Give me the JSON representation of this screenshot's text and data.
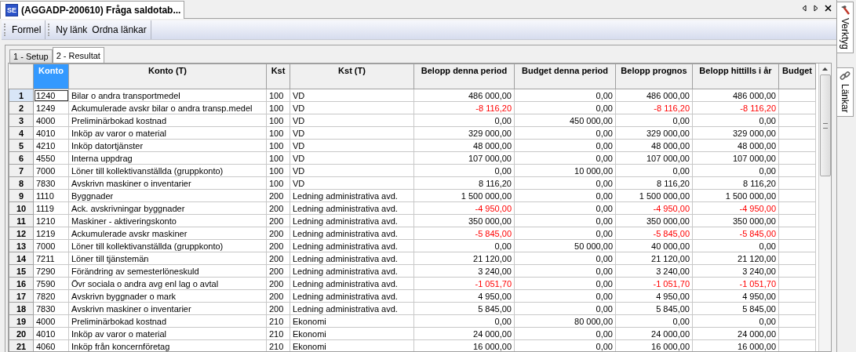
{
  "document_tab": {
    "icon_text": "SE",
    "title": "(AGGADP-200610) Fråga saldotab..."
  },
  "toolbar": [
    {
      "buttons": [
        "Formel"
      ]
    },
    {
      "buttons": [
        "Ny länk",
        "Ordna länkar"
      ]
    }
  ],
  "tabs": [
    {
      "label": "1 - Setup",
      "selected": false
    },
    {
      "label": "2 - Resultat",
      "selected": true
    }
  ],
  "side_tabs": [
    {
      "label": "Verktyg",
      "kind": "tools"
    },
    {
      "label": "Länkar",
      "kind": "links"
    }
  ],
  "table": {
    "columns": [
      {
        "label": "Konto",
        "selected": true
      },
      {
        "label": "Konto (T)",
        "selected": false
      },
      {
        "label": "Kst",
        "selected": false
      },
      {
        "label": "Kst (T)",
        "selected": false
      },
      {
        "label": "Belopp denna period",
        "selected": false
      },
      {
        "label": "Budget denna period",
        "selected": false
      },
      {
        "label": "Belopp prognos",
        "selected": false
      },
      {
        "label": "Belopp hittills i år",
        "selected": false
      },
      {
        "label": "Budget",
        "selected": false
      }
    ],
    "rows": [
      {
        "number": "1",
        "selected": true,
        "cells": [
          {
            "text": "1240",
            "negative": false
          },
          {
            "text": "Bilar o andra transportmedel",
            "negative": false
          },
          {
            "text": "100",
            "negative": false
          },
          {
            "text": "VD",
            "negative": false
          },
          {
            "text": "486 000,00",
            "negative": false
          },
          {
            "text": "0,00",
            "negative": false
          },
          {
            "text": "486 000,00",
            "negative": false
          },
          {
            "text": "486 000,00",
            "negative": false
          }
        ]
      },
      {
        "number": "2",
        "selected": false,
        "cells": [
          {
            "text": "1249",
            "negative": false
          },
          {
            "text": "Ackumulerade avskr bilar o andra transp.medel",
            "negative": false
          },
          {
            "text": "100",
            "negative": false
          },
          {
            "text": "VD",
            "negative": false
          },
          {
            "text": "-8 116,20",
            "negative": true
          },
          {
            "text": "0,00",
            "negative": false
          },
          {
            "text": "-8 116,20",
            "negative": true
          },
          {
            "text": "-8 116,20",
            "negative": true
          }
        ]
      },
      {
        "number": "3",
        "selected": false,
        "cells": [
          {
            "text": "4000",
            "negative": false
          },
          {
            "text": "Preliminärbokad kostnad",
            "negative": false
          },
          {
            "text": "100",
            "negative": false
          },
          {
            "text": "VD",
            "negative": false
          },
          {
            "text": "0,00",
            "negative": false
          },
          {
            "text": "450 000,00",
            "negative": false
          },
          {
            "text": "0,00",
            "negative": false
          },
          {
            "text": "0,00",
            "negative": false
          }
        ]
      },
      {
        "number": "4",
        "selected": false,
        "cells": [
          {
            "text": "4010",
            "negative": false
          },
          {
            "text": "Inköp av varor o material",
            "negative": false
          },
          {
            "text": "100",
            "negative": false
          },
          {
            "text": "VD",
            "negative": false
          },
          {
            "text": "329 000,00",
            "negative": false
          },
          {
            "text": "0,00",
            "negative": false
          },
          {
            "text": "329 000,00",
            "negative": false
          },
          {
            "text": "329 000,00",
            "negative": false
          }
        ]
      },
      {
        "number": "5",
        "selected": false,
        "cells": [
          {
            "text": "4210",
            "negative": false
          },
          {
            "text": "Inköp datortjänster",
            "negative": false
          },
          {
            "text": "100",
            "negative": false
          },
          {
            "text": "VD",
            "negative": false
          },
          {
            "text": "48 000,00",
            "negative": false
          },
          {
            "text": "0,00",
            "negative": false
          },
          {
            "text": "48 000,00",
            "negative": false
          },
          {
            "text": "48 000,00",
            "negative": false
          }
        ]
      },
      {
        "number": "6",
        "selected": false,
        "cells": [
          {
            "text": "4550",
            "negative": false
          },
          {
            "text": "Interna uppdrag",
            "negative": false
          },
          {
            "text": "100",
            "negative": false
          },
          {
            "text": "VD",
            "negative": false
          },
          {
            "text": "107 000,00",
            "negative": false
          },
          {
            "text": "0,00",
            "negative": false
          },
          {
            "text": "107 000,00",
            "negative": false
          },
          {
            "text": "107 000,00",
            "negative": false
          }
        ]
      },
      {
        "number": "7",
        "selected": false,
        "cells": [
          {
            "text": "7000",
            "negative": false
          },
          {
            "text": "Löner till kollektivanställda (gruppkonto)",
            "negative": false
          },
          {
            "text": "100",
            "negative": false
          },
          {
            "text": "VD",
            "negative": false
          },
          {
            "text": "0,00",
            "negative": false
          },
          {
            "text": "10 000,00",
            "negative": false
          },
          {
            "text": "0,00",
            "negative": false
          },
          {
            "text": "0,00",
            "negative": false
          }
        ]
      },
      {
        "number": "8",
        "selected": false,
        "cells": [
          {
            "text": "7830",
            "negative": false
          },
          {
            "text": "Avskrivn maskiner o inventarier",
            "negative": false
          },
          {
            "text": "100",
            "negative": false
          },
          {
            "text": "VD",
            "negative": false
          },
          {
            "text": "8 116,20",
            "negative": false
          },
          {
            "text": "0,00",
            "negative": false
          },
          {
            "text": "8 116,20",
            "negative": false
          },
          {
            "text": "8 116,20",
            "negative": false
          }
        ]
      },
      {
        "number": "9",
        "selected": false,
        "cells": [
          {
            "text": "1110",
            "negative": false
          },
          {
            "text": "Byggnader",
            "negative": false
          },
          {
            "text": "200",
            "negative": false
          },
          {
            "text": "Ledning administrativa avd.",
            "negative": false
          },
          {
            "text": "1 500 000,00",
            "negative": false
          },
          {
            "text": "0,00",
            "negative": false
          },
          {
            "text": "1 500 000,00",
            "negative": false
          },
          {
            "text": "1 500 000,00",
            "negative": false
          }
        ]
      },
      {
        "number": "10",
        "selected": false,
        "cells": [
          {
            "text": "1119",
            "negative": false
          },
          {
            "text": "Ack. avskrivningar byggnader",
            "negative": false
          },
          {
            "text": "200",
            "negative": false
          },
          {
            "text": "Ledning administrativa avd.",
            "negative": false
          },
          {
            "text": "-4 950,00",
            "negative": true
          },
          {
            "text": "0,00",
            "negative": false
          },
          {
            "text": "-4 950,00",
            "negative": true
          },
          {
            "text": "-4 950,00",
            "negative": true
          }
        ]
      },
      {
        "number": "11",
        "selected": false,
        "cells": [
          {
            "text": "1210",
            "negative": false
          },
          {
            "text": "Maskiner - aktiveringskonto",
            "negative": false
          },
          {
            "text": "200",
            "negative": false
          },
          {
            "text": "Ledning administrativa avd.",
            "negative": false
          },
          {
            "text": "350 000,00",
            "negative": false
          },
          {
            "text": "0,00",
            "negative": false
          },
          {
            "text": "350 000,00",
            "negative": false
          },
          {
            "text": "350 000,00",
            "negative": false
          }
        ]
      },
      {
        "number": "12",
        "selected": false,
        "cells": [
          {
            "text": "1219",
            "negative": false
          },
          {
            "text": "Ackumulerade avskr maskiner",
            "negative": false
          },
          {
            "text": "200",
            "negative": false
          },
          {
            "text": "Ledning administrativa avd.",
            "negative": false
          },
          {
            "text": "-5 845,00",
            "negative": true
          },
          {
            "text": "0,00",
            "negative": false
          },
          {
            "text": "-5 845,00",
            "negative": true
          },
          {
            "text": "-5 845,00",
            "negative": true
          }
        ]
      },
      {
        "number": "13",
        "selected": false,
        "cells": [
          {
            "text": "7000",
            "negative": false
          },
          {
            "text": "Löner till kollektivanställda (gruppkonto)",
            "negative": false
          },
          {
            "text": "200",
            "negative": false
          },
          {
            "text": "Ledning administrativa avd.",
            "negative": false
          },
          {
            "text": "0,00",
            "negative": false
          },
          {
            "text": "50 000,00",
            "negative": false
          },
          {
            "text": "40 000,00",
            "negative": false
          },
          {
            "text": "0,00",
            "negative": false
          }
        ]
      },
      {
        "number": "14",
        "selected": false,
        "cells": [
          {
            "text": "7211",
            "negative": false
          },
          {
            "text": "Löner till tjänstemän",
            "negative": false
          },
          {
            "text": "200",
            "negative": false
          },
          {
            "text": "Ledning administrativa avd.",
            "negative": false
          },
          {
            "text": "21 120,00",
            "negative": false
          },
          {
            "text": "0,00",
            "negative": false
          },
          {
            "text": "21 120,00",
            "negative": false
          },
          {
            "text": "21 120,00",
            "negative": false
          }
        ]
      },
      {
        "number": "15",
        "selected": false,
        "cells": [
          {
            "text": "7290",
            "negative": false
          },
          {
            "text": "Förändring av semesterlöneskuld",
            "negative": false
          },
          {
            "text": "200",
            "negative": false
          },
          {
            "text": "Ledning administrativa avd.",
            "negative": false
          },
          {
            "text": "3 240,00",
            "negative": false
          },
          {
            "text": "0,00",
            "negative": false
          },
          {
            "text": "3 240,00",
            "negative": false
          },
          {
            "text": "3 240,00",
            "negative": false
          }
        ]
      },
      {
        "number": "16",
        "selected": false,
        "cells": [
          {
            "text": "7590",
            "negative": false
          },
          {
            "text": "Övr sociala o andra avg enl lag o avtal",
            "negative": false
          },
          {
            "text": "200",
            "negative": false
          },
          {
            "text": "Ledning administrativa avd.",
            "negative": false
          },
          {
            "text": "-1 051,70",
            "negative": true
          },
          {
            "text": "0,00",
            "negative": false
          },
          {
            "text": "-1 051,70",
            "negative": true
          },
          {
            "text": "-1 051,70",
            "negative": true
          }
        ]
      },
      {
        "number": "17",
        "selected": false,
        "cells": [
          {
            "text": "7820",
            "negative": false
          },
          {
            "text": "Avskrivn byggnader o mark",
            "negative": false
          },
          {
            "text": "200",
            "negative": false
          },
          {
            "text": "Ledning administrativa avd.",
            "negative": false
          },
          {
            "text": "4 950,00",
            "negative": false
          },
          {
            "text": "0,00",
            "negative": false
          },
          {
            "text": "4 950,00",
            "negative": false
          },
          {
            "text": "4 950,00",
            "negative": false
          }
        ]
      },
      {
        "number": "18",
        "selected": false,
        "cells": [
          {
            "text": "7830",
            "negative": false
          },
          {
            "text": "Avskrivn maskiner o inventarier",
            "negative": false
          },
          {
            "text": "200",
            "negative": false
          },
          {
            "text": "Ledning administrativa avd.",
            "negative": false
          },
          {
            "text": "5 845,00",
            "negative": false
          },
          {
            "text": "0,00",
            "negative": false
          },
          {
            "text": "5 845,00",
            "negative": false
          },
          {
            "text": "5 845,00",
            "negative": false
          }
        ]
      },
      {
        "number": "19",
        "selected": false,
        "cells": [
          {
            "text": "4000",
            "negative": false
          },
          {
            "text": "Preliminärbokad kostnad",
            "negative": false
          },
          {
            "text": "210",
            "negative": false
          },
          {
            "text": "Ekonomi",
            "negative": false
          },
          {
            "text": "0,00",
            "negative": false
          },
          {
            "text": "80 000,00",
            "negative": false
          },
          {
            "text": "0,00",
            "negative": false
          },
          {
            "text": "0,00",
            "negative": false
          }
        ]
      },
      {
        "number": "20",
        "selected": false,
        "cells": [
          {
            "text": "4010",
            "negative": false
          },
          {
            "text": "Inköp av varor o material",
            "negative": false
          },
          {
            "text": "210",
            "negative": false
          },
          {
            "text": "Ekonomi",
            "negative": false
          },
          {
            "text": "24 000,00",
            "negative": false
          },
          {
            "text": "0,00",
            "negative": false
          },
          {
            "text": "24 000,00",
            "negative": false
          },
          {
            "text": "24 000,00",
            "negative": false
          }
        ]
      },
      {
        "number": "21",
        "selected": false,
        "cells": [
          {
            "text": "4060",
            "negative": false
          },
          {
            "text": "Inköp från koncernföretag",
            "negative": false
          },
          {
            "text": "210",
            "negative": false
          },
          {
            "text": "Ekonomi",
            "negative": false
          },
          {
            "text": "16 000,00",
            "negative": false
          },
          {
            "text": "0,00",
            "negative": false
          },
          {
            "text": "16 000,00",
            "negative": false
          },
          {
            "text": "16 000,00",
            "negative": false
          }
        ]
      }
    ]
  }
}
